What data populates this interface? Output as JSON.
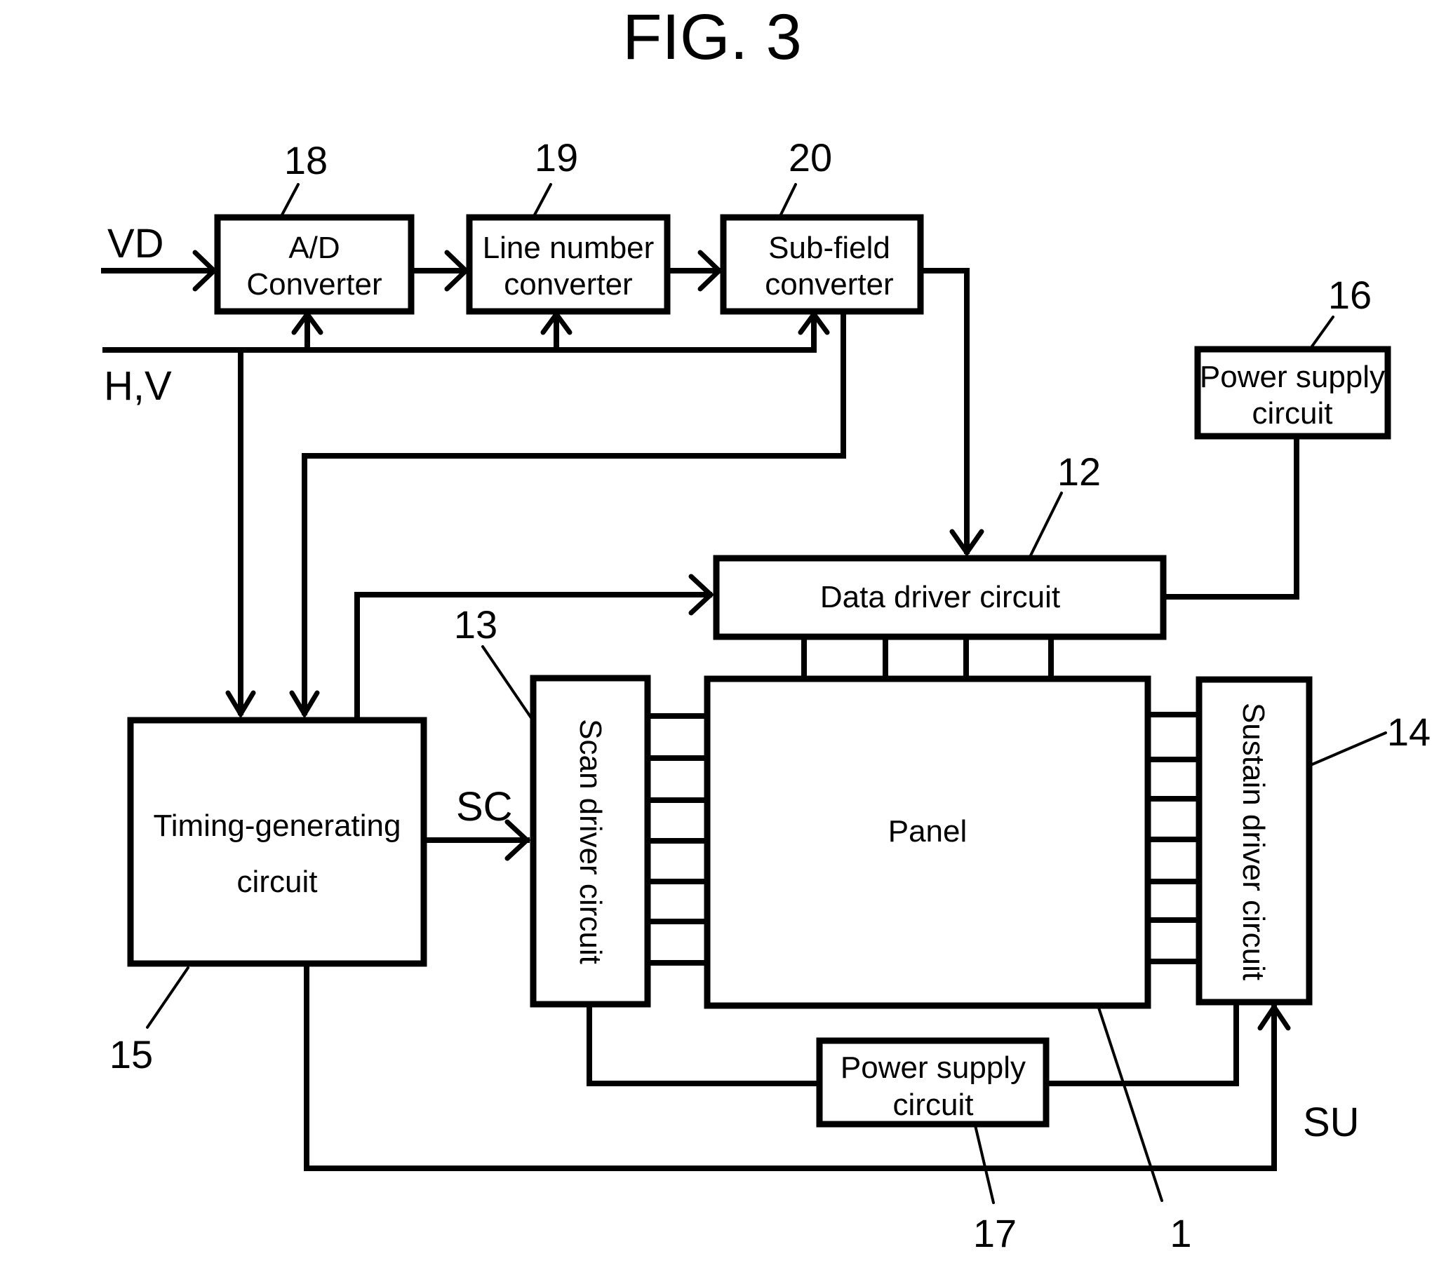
{
  "title": "FIG. 3",
  "blocks": {
    "ad": {
      "ref": "18",
      "line1": "A/D",
      "line2": "Converter"
    },
    "line_number": {
      "ref": "19",
      "line1": "Line number",
      "line2": "converter"
    },
    "sub_field": {
      "ref": "20",
      "line1": "Sub-field",
      "line2": "converter"
    },
    "power_supply_16": {
      "ref": "16",
      "line1": "Power supply",
      "line2": "circuit"
    },
    "data_driver": {
      "ref": "12",
      "label": "Data driver circuit"
    },
    "scan_driver": {
      "ref": "13",
      "label": "Scan driver circuit"
    },
    "panel": {
      "ref": "1",
      "label": "Panel"
    },
    "sustain_driver": {
      "ref": "14",
      "label": "Sustain driver circuit"
    },
    "timing": {
      "ref": "15",
      "line1": "Timing-generating",
      "line2": "circuit"
    },
    "power_supply_17": {
      "ref": "17",
      "line1": "Power supply",
      "line2": "circuit"
    }
  },
  "signals": {
    "vd": "VD",
    "hv": "H,V",
    "sc": "SC",
    "su": "SU"
  }
}
